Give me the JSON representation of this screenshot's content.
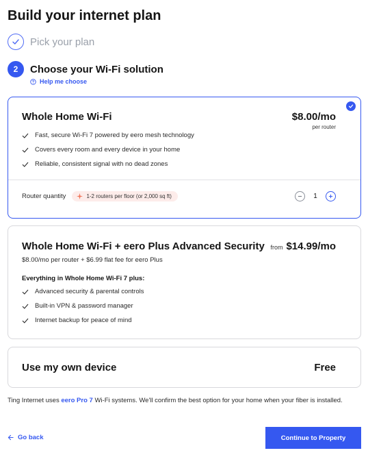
{
  "page_title": "Build your internet plan",
  "steps": [
    {
      "label": "Pick your plan",
      "number": "1",
      "status": "done"
    },
    {
      "label": "Choose your Wi-Fi solution",
      "number": "2",
      "status": "active"
    }
  ],
  "help_link": "Help me choose",
  "plans": [
    {
      "name": "Whole Home Wi-Fi",
      "price": "$8.00/mo",
      "price_sub": "per router",
      "selected": true,
      "features": [
        "Fast, secure Wi-Fi 7 powered by eero mesh technology",
        "Covers every room and every device in your home",
        "Reliable, consistent signal with no dead zones"
      ],
      "quantity_label": "Router quantity",
      "quantity_hint": "1-2 routers per floor (or 2,000 sq ft)",
      "quantity": "1"
    },
    {
      "name": "Whole Home Wi-Fi + eero Plus Advanced Security",
      "price_prefix": "from",
      "price": "$14.99/mo",
      "subtitle": "$8.00/mo per router + $6.99 flat fee for eero Plus",
      "features_heading": "Everything in Whole Home Wi-Fi 7 plus:",
      "features": [
        "Advanced security & parental controls",
        "Built-in VPN & password manager",
        "Internet backup for peace of mind"
      ]
    },
    {
      "name": "Use my own device",
      "price": "Free"
    }
  ],
  "footer": {
    "note_before": "Ting Internet uses ",
    "note_link": "eero Pro 7",
    "note_after": " Wi-Fi systems. We'll confirm the best option for your home when your fiber is installed."
  },
  "nav": {
    "back_label": "Go back",
    "continue_label": "Continue to Property"
  },
  "colors": {
    "accent": "#3558f0",
    "hint_bg": "#fdecea",
    "hint_icon": "#f0765a"
  }
}
